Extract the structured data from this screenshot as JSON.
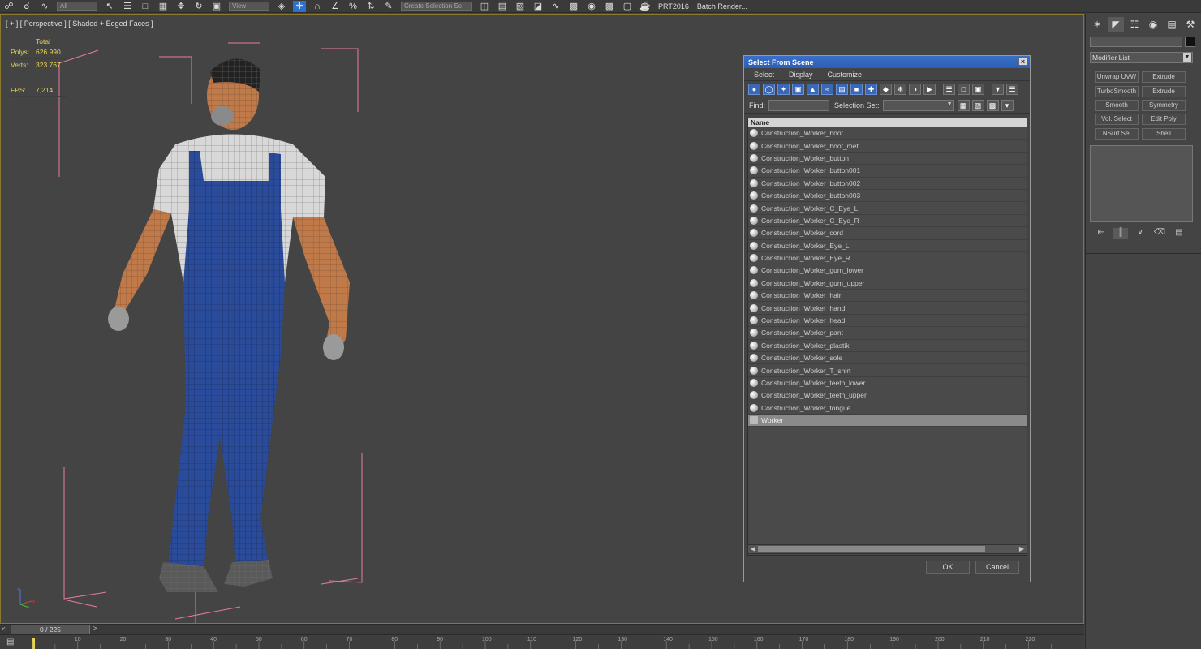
{
  "toolbar": {
    "selection_filter": "All",
    "view_dropdown": "View",
    "named_selection": "Create Selection Se",
    "project_label": "PRT2016",
    "batch_render_label": "Batch Render..."
  },
  "viewport": {
    "label": "[ + ] [ Perspective ] [ Shaded + Edged Faces ]",
    "stats": {
      "header": "Total",
      "polys_label": "Polys:",
      "polys_value": "626 990",
      "verts_label": "Verts:",
      "verts_value": "323 767",
      "fps_label": "FPS:",
      "fps_value": "7,214"
    },
    "axis": {
      "x": "x",
      "y": "y",
      "z": "z"
    }
  },
  "dialog": {
    "title": "Select From Scene",
    "close_glyph": "×",
    "menus": [
      "Select",
      "Display",
      "Customize"
    ],
    "find_label": "Find:",
    "find_value": "",
    "selset_label": "Selection Set:",
    "selset_value": "",
    "column_name": "Name",
    "items": [
      "Construction_Worker_boot",
      "Construction_Worker_boot_met",
      "Construction_Worker_button",
      "Construction_Worker_button001",
      "Construction_Worker_button002",
      "Construction_Worker_button003",
      "Construction_Worker_C_Eye_L",
      "Construction_Worker_C_Eye_R",
      "Construction_Worker_cord",
      "Construction_Worker_Eye_L",
      "Construction_Worker_Eye_R",
      "Construction_Worker_gum_lower",
      "Construction_Worker_gum_upper",
      "Construction_Worker_hair",
      "Construction_Worker_hand",
      "Construction_Worker_head",
      "Construction_Worker_pant",
      "Construction_Worker_plastik",
      "Construction_Worker_sole",
      "Construction_Worker_T_shirt",
      "Construction_Worker_teeth_lower",
      "Construction_Worker_teeth_upper",
      "Construction_Worker_tongue"
    ],
    "group_item": "Worker",
    "ok_label": "OK",
    "cancel_label": "Cancel"
  },
  "command_panel": {
    "modifier_list_label": "Modifier List",
    "modifier_buttons": [
      "Unwrap UVW",
      "Extrude",
      "TurboSmooth",
      "Extrude",
      "Smooth",
      "Symmetry",
      "Vol. Select",
      "Edit Poly",
      "NSurf Sel",
      "Shell"
    ]
  },
  "timeline": {
    "frame_readout": "0 / 225",
    "prev_glyph": "<",
    "next_glyph": ">",
    "tick_labels": [
      "10",
      "20",
      "30",
      "40",
      "50",
      "60",
      "70",
      "80",
      "90",
      "100",
      "110",
      "120",
      "130",
      "140",
      "150",
      "160",
      "170",
      "180",
      "190",
      "200",
      "210",
      "220"
    ]
  },
  "colors": {
    "accent": "#2e6fd0",
    "stats_text": "#e8d44d",
    "bbox": "#e87aa0",
    "mesh_blue": "#2a4a9a"
  }
}
